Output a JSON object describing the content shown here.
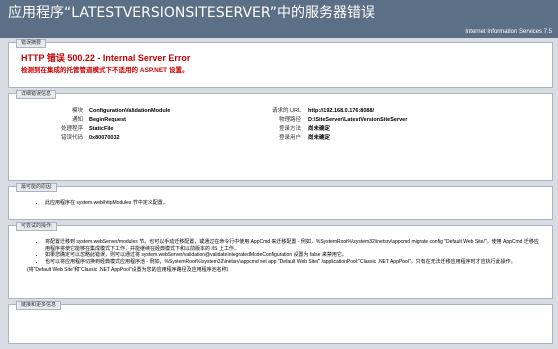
{
  "banner": {
    "title": "应用程序“LATESTVERSIONSITESERVER”中的服务器错误",
    "server": "Internet Information Services 7.5"
  },
  "summary": {
    "tab": "错误摘要",
    "title": "HTTP 错误 500.22 - Internal Server Error",
    "description": "检测到在集成的托管管道模式下不适用的 ASP.NET 设置。"
  },
  "details": {
    "tab": "详细错误信息",
    "left": [
      {
        "label": "模块",
        "value": "ConfigurationValidationModule"
      },
      {
        "label": "通知",
        "value": "BeginRequest"
      },
      {
        "label": "处理程序",
        "value": "StaticFile"
      },
      {
        "label": "错误代码",
        "value": "0x80070032"
      }
    ],
    "right": [
      {
        "label": "请求的 URL",
        "value": "http://192.168.0.176:8088/"
      },
      {
        "label": "物理路径",
        "value": "D:\\SiteServer\\LatestVersionSiteServer"
      },
      {
        "label": "登录方法",
        "value": "尚未确定"
      },
      {
        "label": "登录用户",
        "value": "尚未确定"
      }
    ]
  },
  "cause": {
    "tab": "最可能的原因:",
    "items": [
      "此应用程序在 system.web/httpModules 节中定义配置。"
    ]
  },
  "fix": {
    "tab": "可尝试的操作:",
    "items": [
      "将配置迁移到 system.webServer/modules 节。也可以手动迁移配置，或通过在命令行中使用 AppCmd 来迁移配置 - 例如，%SystemRoot%\\system32\\inetsrv\\appcmd migrate config \"Default Web Site/\"。使用 AppCmd 迁移应用程序将使它能够在集成模式下工作，并能继续在经典模式下和以前版本的 IIS 上工作。",
      "如果您确定可以忽略此错误，则可以通过将 system.webServer/validation@validateIntegratedModeConfiguration 设置为 false 来禁用它。",
      "也可以将应用程序切换到经典模式应用程序池 - 例如，%SystemRoot%\\system32\\inetsrv\\appcmd set app \"Default Web Site/\" /applicationPool:\"Classic .NET AppPool\"。只有在无法迁移应用程序时才应执行此操作。"
    ],
    "note": "(将“Default Web Site”和“Classic .NET AppPool”设置为您的应用程序路径及应用程序池名称)"
  },
  "more": {
    "tab": "链接和更多信息"
  }
}
